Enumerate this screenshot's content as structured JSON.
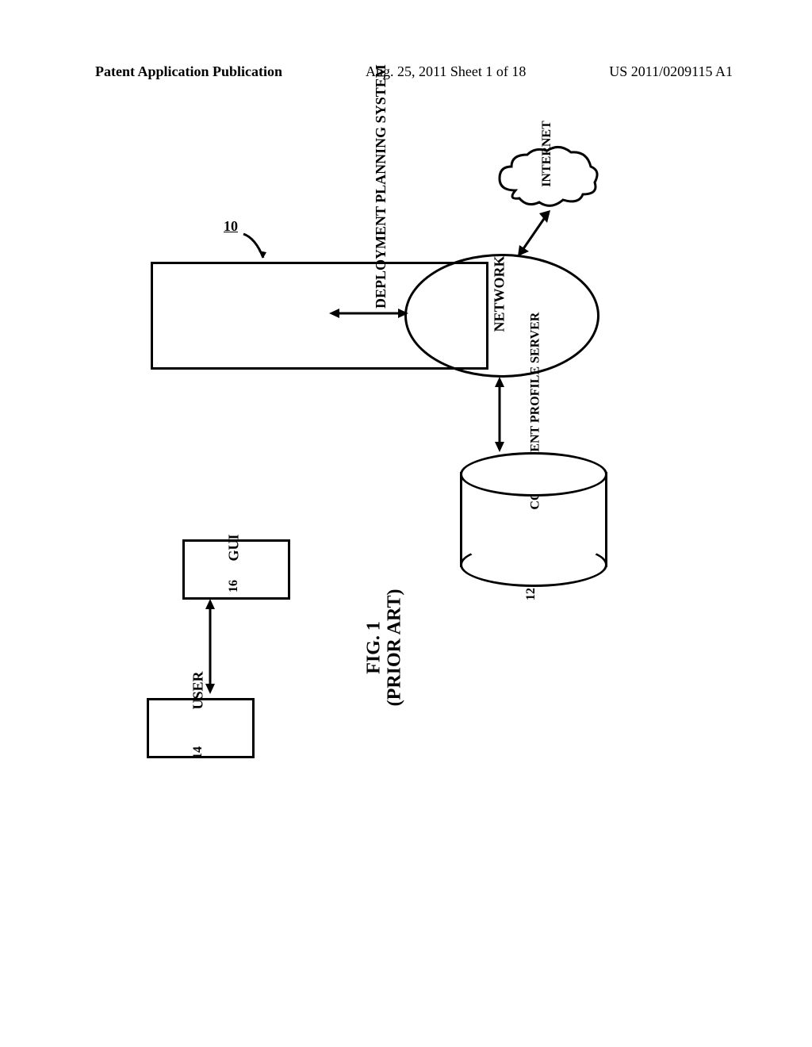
{
  "header": {
    "left": "Patent Application Publication",
    "center": "Aug. 25, 2011  Sheet 1 of 18",
    "right": "US 2011/0209115 A1"
  },
  "diagram": {
    "user": {
      "label": "USER",
      "number": "14"
    },
    "gui": {
      "label": "GUI",
      "number": "16"
    },
    "deployment": {
      "label": "DEPLOYMENT PLANNING SYSTEM",
      "ref": "10"
    },
    "network": {
      "label": "NETWORK"
    },
    "internet": {
      "label": "INTERNET"
    },
    "server": {
      "label": "COMPONENT PROFILE SERVER",
      "number": "12"
    },
    "caption": {
      "line1": "FIG. 1",
      "line2": "(PRIOR ART)"
    }
  }
}
